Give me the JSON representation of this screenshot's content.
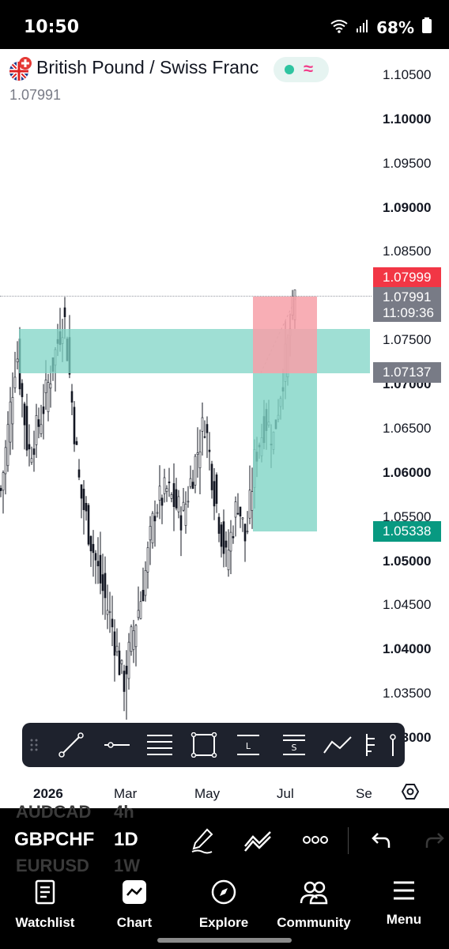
{
  "status_bar": {
    "time": "10:50",
    "battery": "68%"
  },
  "header": {
    "title": "British Pound / Swiss Franc",
    "price": "1.07991"
  },
  "chart_data": {
    "type": "candlestick",
    "title": "British Pound / Swiss Franc",
    "y_ticks": [
      "1.10500",
      "1.10000",
      "1.09500",
      "1.09000",
      "1.08500",
      "1.07500",
      "1.07000",
      "1.06500",
      "1.06000",
      "1.05500",
      "1.05000",
      "1.04500",
      "1.04000",
      "1.03500",
      "1.03000"
    ],
    "y_range": [
      1.0275,
      1.1105
    ],
    "x_ticks": [
      "2026",
      "Mar",
      "May",
      "Jul",
      "Se"
    ],
    "price_tags": [
      {
        "label": "1.07999",
        "color": "#f23645",
        "value": 1.07999
      },
      {
        "label": "1.07991",
        "sub": "11:09:36",
        "color": "#787b86",
        "value": 1.07991
      },
      {
        "label": "1.07137",
        "color": "#787b86",
        "value": 1.07137
      },
      {
        "label": "1.05338",
        "color": "#089981",
        "value": 1.05338
      }
    ],
    "zones": [
      {
        "type": "demand",
        "from": 1.0713,
        "to": 1.0763,
        "color": "#7fd4c5"
      },
      {
        "type": "position_stop",
        "from": 1.0713,
        "to": 1.0799,
        "color": "#f7a0a8"
      },
      {
        "type": "position_target",
        "from": 1.0534,
        "to": 1.0713,
        "color": "#7fd4c5"
      }
    ]
  },
  "toolbar": {
    "tools": [
      "trend-line-icon",
      "horizontal-ray-icon",
      "parallel-channel-icon",
      "rectangle-icon",
      "long-position-icon",
      "short-position-icon",
      "path-icon",
      "fib-icon"
    ]
  },
  "time_axis": {
    "labels": [
      "2026",
      "Mar",
      "May",
      "Jul",
      "Se"
    ]
  },
  "symbol_bar": {
    "symbol_above": "AUDCAD",
    "interval_above": "4h",
    "symbol": "GBPCHF",
    "interval": "1D",
    "symbol_below": "EURUSD",
    "interval_below": "1W"
  },
  "bottom_nav": {
    "items": [
      {
        "label": "Watchlist",
        "icon": "watchlist-icon"
      },
      {
        "label": "Chart",
        "icon": "chart-icon"
      },
      {
        "label": "Explore",
        "icon": "compass-icon"
      },
      {
        "label": "Community",
        "icon": "community-icon"
      },
      {
        "label": "Menu",
        "icon": "menu-icon"
      }
    ]
  },
  "colors": {
    "up": "#131722",
    "sell": "#f23645",
    "buy": "#089981",
    "teal_zone": "#7fd4c5"
  }
}
